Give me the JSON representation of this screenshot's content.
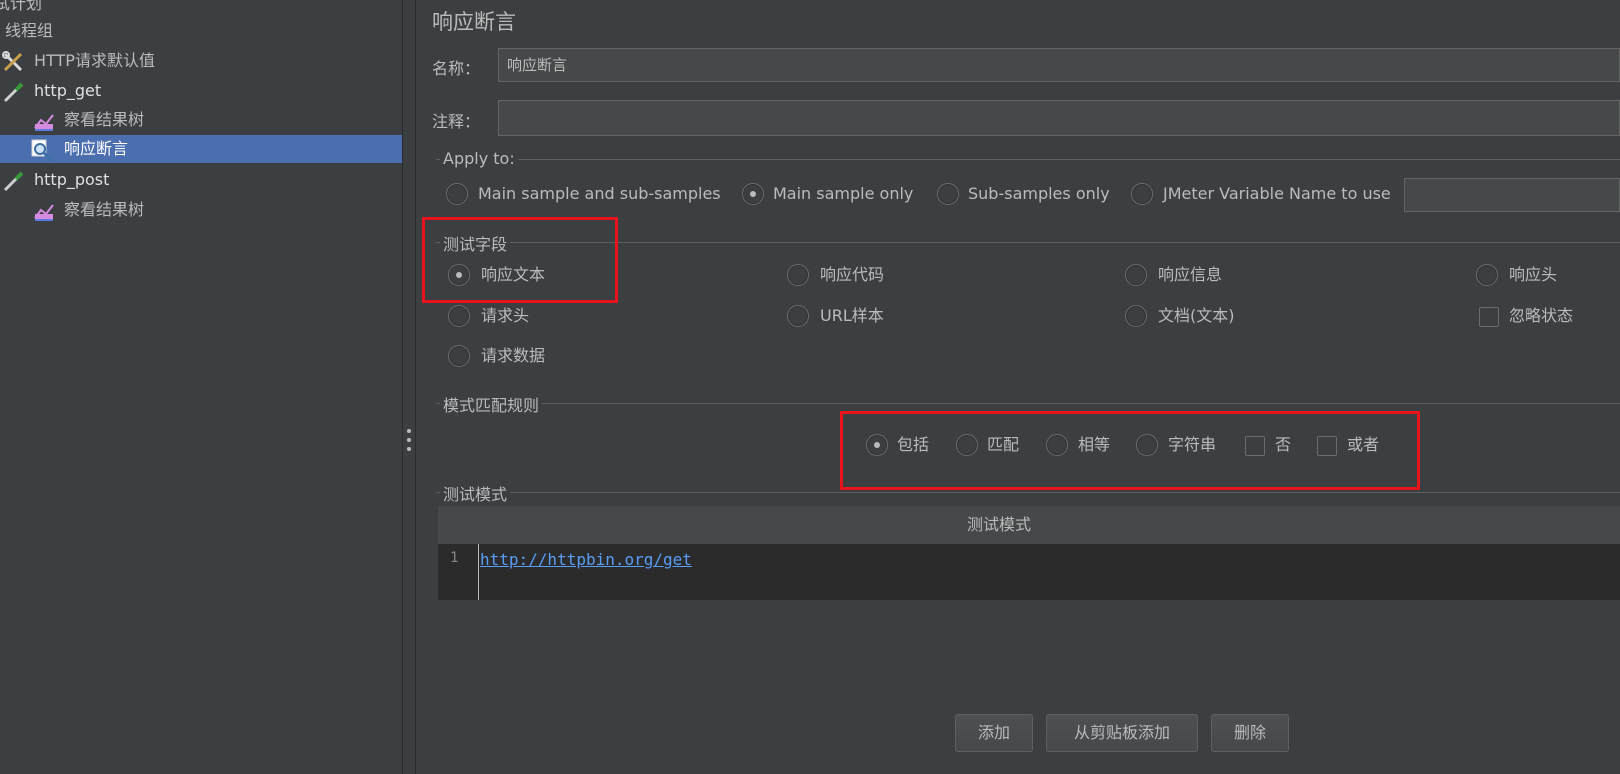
{
  "tree": {
    "items": [
      {
        "label": "试计划"
      },
      {
        "label": "线程组"
      },
      {
        "label": "HTTP请求默认值"
      },
      {
        "label": "http_get"
      },
      {
        "label": "察看结果树"
      },
      {
        "label": "响应断言"
      },
      {
        "label": "http_post"
      },
      {
        "label": "察看结果树"
      }
    ]
  },
  "panel": {
    "title": "响应断言",
    "name_label": "名称：",
    "name_value": "响应断言",
    "comment_label": "注释：",
    "comment_value": ""
  },
  "apply_to": {
    "title": "Apply to:",
    "options": [
      {
        "label": "Main sample and sub-samples",
        "checked": false
      },
      {
        "label": "Main sample only",
        "checked": true
      },
      {
        "label": "Sub-samples only",
        "checked": false
      },
      {
        "label": "JMeter Variable Name to use",
        "checked": false
      }
    ],
    "variable_value": ""
  },
  "test_field": {
    "title": "测试字段",
    "options": [
      {
        "label": "响应文本",
        "type": "radio",
        "checked": true
      },
      {
        "label": "响应代码",
        "type": "radio",
        "checked": false
      },
      {
        "label": "响应信息",
        "type": "radio",
        "checked": false
      },
      {
        "label": "响应头",
        "type": "radio",
        "checked": false
      },
      {
        "label": "请求头",
        "type": "radio",
        "checked": false
      },
      {
        "label": "URL样本",
        "type": "radio",
        "checked": false
      },
      {
        "label": "文档(文本)",
        "type": "radio",
        "checked": false
      },
      {
        "label": "忽略状态",
        "type": "checkbox",
        "checked": false
      },
      {
        "label": "请求数据",
        "type": "radio",
        "checked": false
      }
    ]
  },
  "match_rules": {
    "title": "模式匹配规则",
    "options": [
      {
        "label": "包括",
        "type": "radio",
        "checked": true
      },
      {
        "label": "匹配",
        "type": "radio",
        "checked": false
      },
      {
        "label": "相等",
        "type": "radio",
        "checked": false
      },
      {
        "label": "字符串",
        "type": "radio",
        "checked": false
      },
      {
        "label": "否",
        "type": "checkbox",
        "checked": false
      },
      {
        "label": "或者",
        "type": "checkbox",
        "checked": false
      }
    ]
  },
  "patterns": {
    "title": "测试模式",
    "column_header": "测试模式",
    "rows": [
      {
        "line": "1",
        "value": "http://httpbin.org/get"
      }
    ]
  },
  "buttons": {
    "add": "添加",
    "add_clipboard": "从剪贴板添加",
    "delete": "删除"
  },
  "colors": {
    "background": "#3c3f41",
    "selection": "#4b6eaf",
    "highlight_border": "#e8141b",
    "link": "#589df6"
  }
}
